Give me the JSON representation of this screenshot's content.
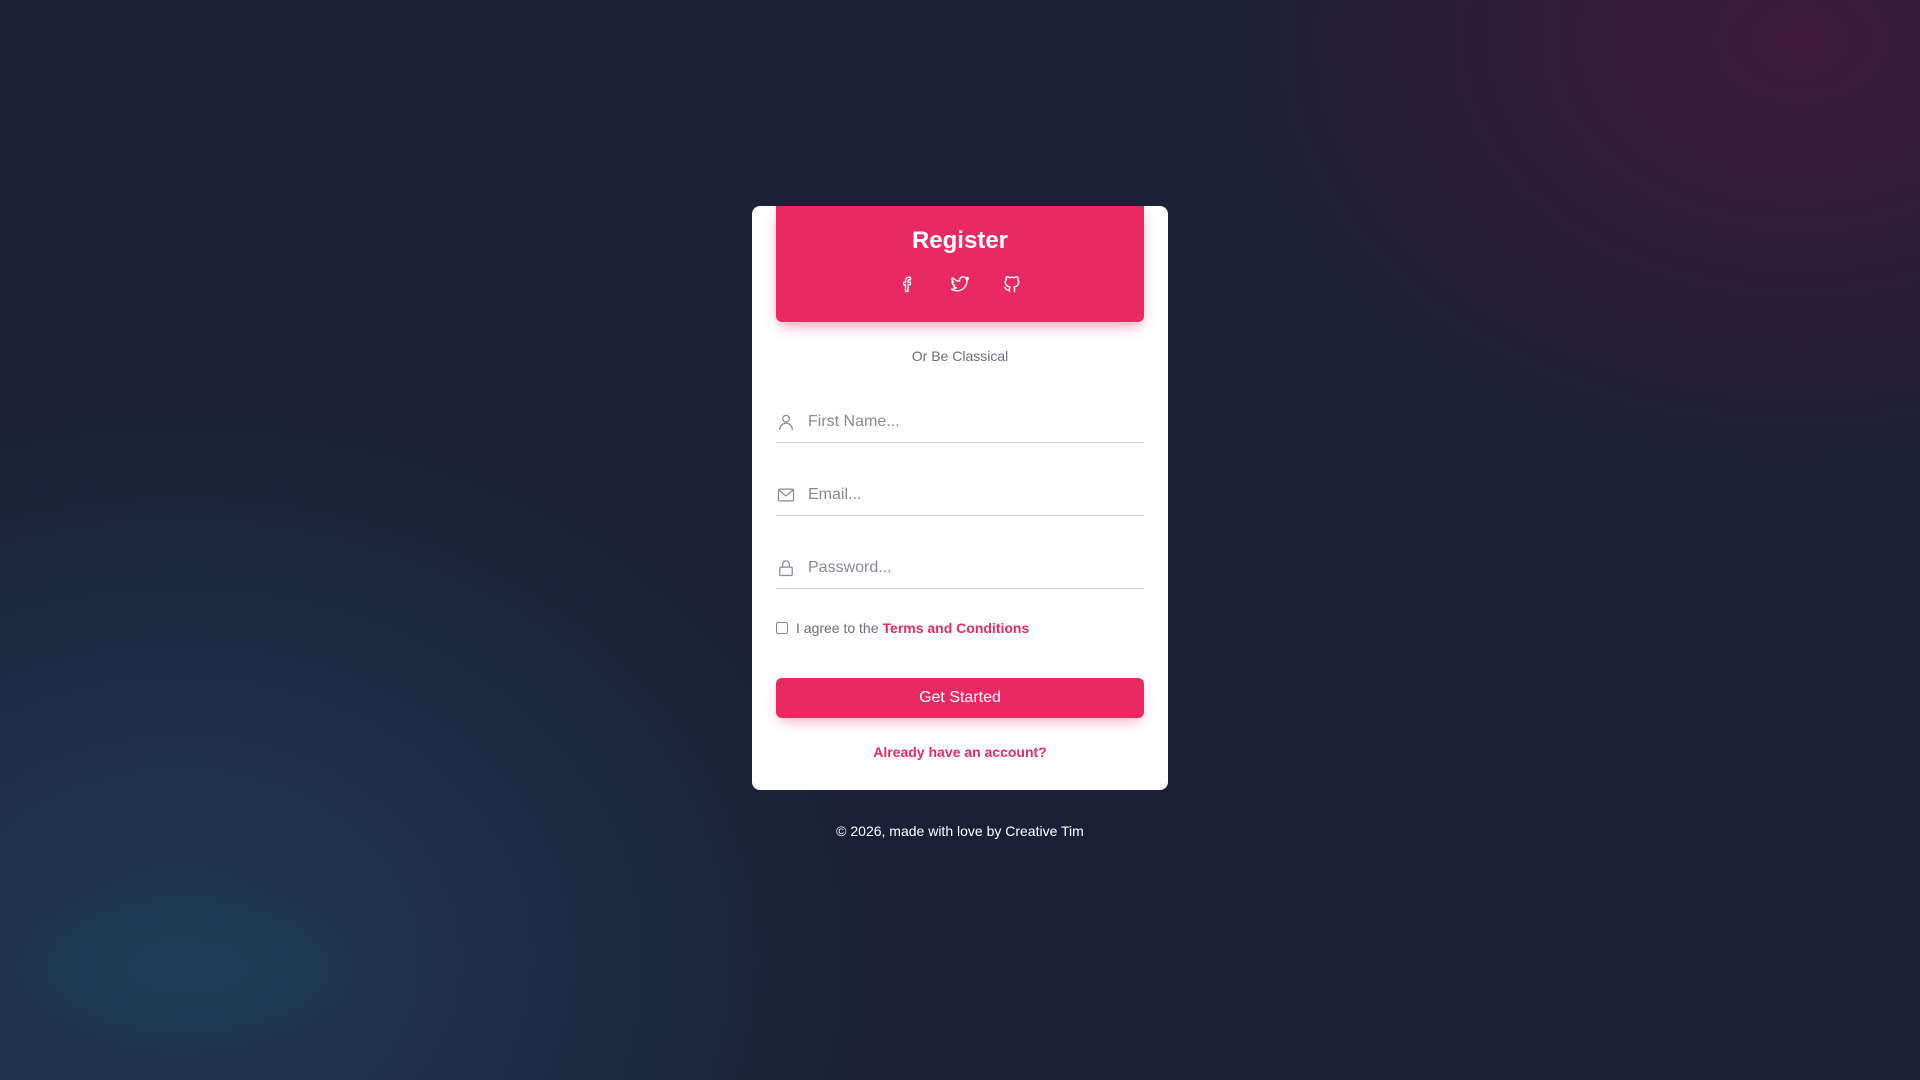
{
  "header": {
    "title": "Register",
    "social": [
      {
        "name": "facebook-icon"
      },
      {
        "name": "twitter-icon"
      },
      {
        "name": "github-icon"
      }
    ]
  },
  "divider_text": "Or Be Classical",
  "form": {
    "first_name": {
      "placeholder": "First Name...",
      "value": "",
      "icon": "user-icon"
    },
    "email": {
      "placeholder": "Email...",
      "value": "",
      "icon": "mail-icon"
    },
    "password": {
      "placeholder": "Password...",
      "value": "",
      "icon": "lock-icon"
    }
  },
  "terms": {
    "checked": false,
    "prefix": "I agree to the",
    "link": "Terms and Conditions"
  },
  "cta_label": "Get Started",
  "signin_link": "Already have an account?",
  "footer": {
    "prefix": "© 2026, made with love by",
    "link": "Creative Tim"
  },
  "colors": {
    "accent": "#e92a62",
    "background": "#1b2038",
    "card": "#ffffff",
    "muted_text": "#6e6e7e"
  }
}
